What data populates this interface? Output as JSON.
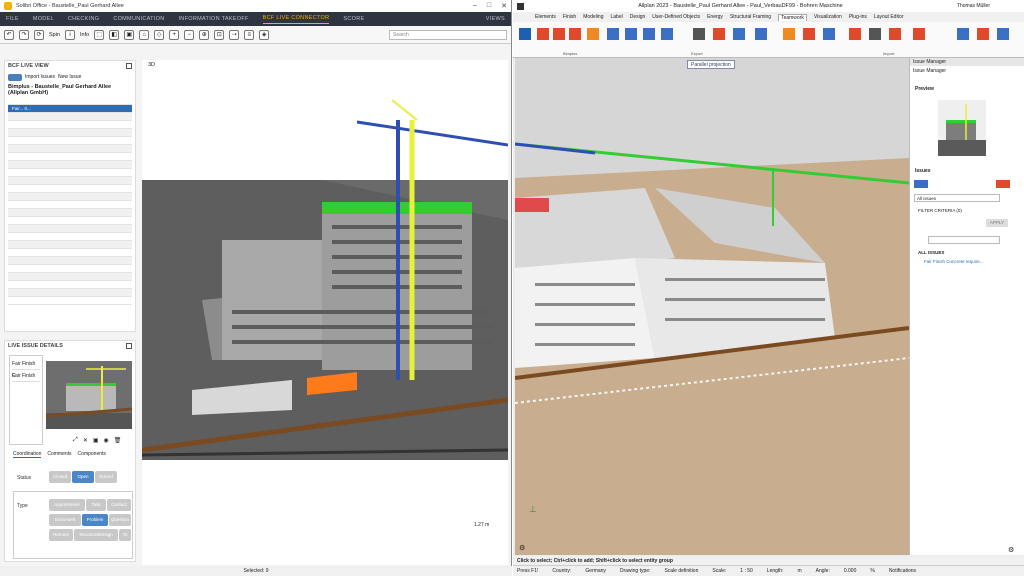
{
  "left": {
    "title": "Solibri Office - Baustelle_Paul Gerhard Allee",
    "menu": [
      "FILE",
      "MODEL",
      "CHECKING",
      "COMMUNICATION",
      "INFORMATION TAKEOFF",
      "BCF LIVE CONNECTOR",
      "SCORE"
    ],
    "menu_views": "VIEWS",
    "toolbar": {
      "spin": "Spin",
      "info": "Info",
      "search_placeholder": "Search"
    },
    "bcf": {
      "title": "BCF LIVE VIEW",
      "import": "Import Issues",
      "new": "New Issue",
      "project": "Bimplus - Baustelle_Paul Gerhard Allee (Allplan GmbH)",
      "selected_row": "Fair... 0..."
    },
    "issue": {
      "title": "LIVE ISSUE DETAILS",
      "items": [
        "Fair Finish C",
        "Fair Finish"
      ],
      "tabs": [
        "Coordination",
        "Comments",
        "Components"
      ],
      "status_label": "Status",
      "status_opts": [
        "Closed",
        "Open",
        "Solved"
      ],
      "type_label": "Type",
      "type_opts": [
        "Appointment",
        "Task",
        "Contact",
        "Document",
        "Problem",
        "Question",
        "Remark",
        "StructuralDesign",
        "To"
      ]
    },
    "view_label": "3D",
    "status": "Selected: 9",
    "measure": "1.27 m"
  },
  "right": {
    "title": "Allplan 2023 - Baustelle_Paul Gerhard Allee - Paul_VerbauDF99 - Bohren Maschine",
    "user": "Thomas Müller",
    "tabs": [
      "Elements",
      "Finish",
      "Modeling",
      "Label",
      "Design",
      "User-Defined Objects",
      "Energy",
      "Structural Framing",
      "Teamwork",
      "Visualization",
      "Plug-ins",
      "Layout Editor"
    ],
    "groups": [
      "Bimplus",
      "Export",
      "Import"
    ],
    "parallel": "Parallel projection",
    "im": {
      "head": "Issue Manager",
      "sub": "Issue Manager",
      "preview": "Preview",
      "issues": "Issues",
      "filter_select": "All issues",
      "filter": "FILTER CRITERIA (0)",
      "apply": "APPLY",
      "all": "ALL ISSUES",
      "issue_item": "Fair Finish Concrete require..."
    },
    "status1": "Click to select; Ctrl+click to add; Shift+click to select entity group",
    "status2": [
      "Press F1!",
      "Country:",
      "Germany",
      "Drawing type:",
      "Scale definition",
      "Scale:",
      "1 : 50",
      "Length:",
      "m",
      "Angle:",
      "0.000",
      "%",
      "Notifications"
    ]
  },
  "colors": {
    "accent": "#f0b400",
    "blue": "#2e6db4",
    "crane_yellow": "#e7f03a",
    "crane_blue": "#2d4fb3",
    "roof_green": "#33cc33"
  }
}
